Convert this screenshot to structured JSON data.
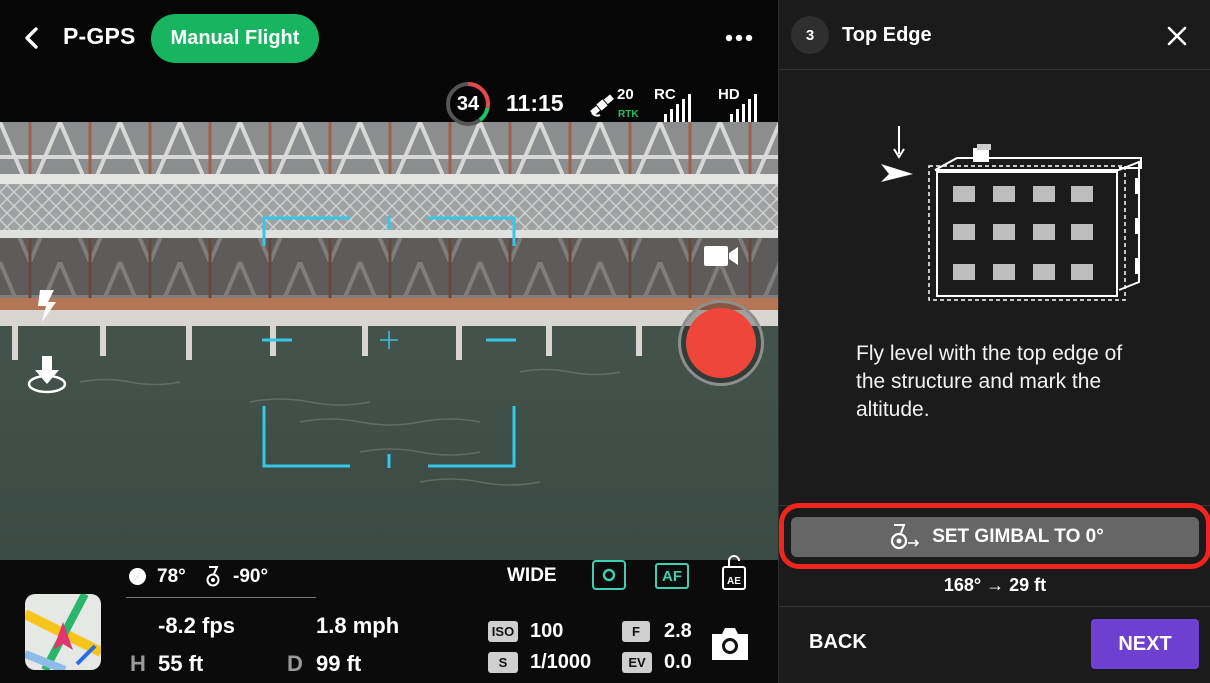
{
  "header": {
    "mode": "P-GPS",
    "flight_mode": "Manual Flight"
  },
  "status": {
    "battery": "34",
    "time": "11:15",
    "satellites": "20",
    "rtk_label": "RTK",
    "rc_label": "RC",
    "hd_label": "HD"
  },
  "telemetry": {
    "heading": "78°",
    "gimbal_pitch": "-90°",
    "vertical_speed": "-8.2 fps",
    "horizontal_speed": "1.8 mph",
    "height_label": "H",
    "height": "55 ft",
    "distance_label": "D",
    "distance": "99 ft"
  },
  "camera": {
    "lens": "WIDE",
    "af_label": "AF",
    "ae_label": "AE",
    "iso_label": "ISO",
    "iso": "100",
    "shutter_label": "S",
    "shutter": "1/1000",
    "aperture_label": "F",
    "aperture": "2.8",
    "ev_label": "EV",
    "ev": "0.0"
  },
  "panel": {
    "step": "3",
    "title": "Top Edge",
    "instructions": "Fly level with the top edge of the structure and mark the altitude.",
    "gimbal_button": "SET GIMBAL TO 0°",
    "reading": "168° → 29 ft",
    "back_label": "BACK",
    "next_label": "NEXT"
  },
  "colors": {
    "flight_mode_pill": "#17b55f",
    "record_button": "#f0453a",
    "focus_frame": "#35c7e8",
    "next_button": "#6f3fd2",
    "highlight_outline": "#f0251e",
    "rtk": "#19c46a"
  }
}
